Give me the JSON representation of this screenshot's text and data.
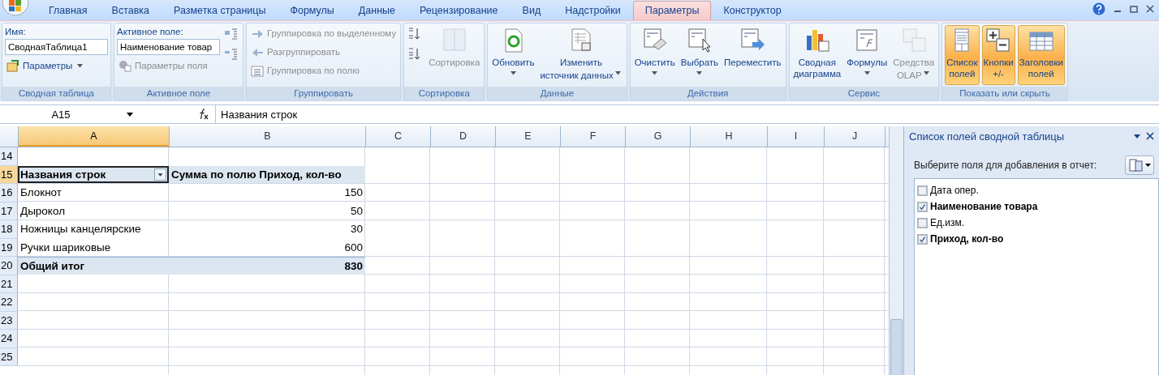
{
  "tabs": [
    {
      "label": "Главная",
      "selected": false
    },
    {
      "label": "Вставка",
      "selected": false
    },
    {
      "label": "Разметка страницы",
      "selected": false
    },
    {
      "label": "Формулы",
      "selected": false
    },
    {
      "label": "Данные",
      "selected": false
    },
    {
      "label": "Рецензирование",
      "selected": false
    },
    {
      "label": "Вид",
      "selected": false
    },
    {
      "label": "Надстройки",
      "selected": false
    },
    {
      "label": "Параметры",
      "selected": true
    },
    {
      "label": "Конструктор",
      "selected": false
    }
  ],
  "ribbon": [
    {
      "title": "Сводная таблица",
      "columns": [
        [
          {
            "kind": "field",
            "label": "Имя:",
            "value": "СводнаяТаблица1"
          },
          {
            "kind": "small",
            "label": "Параметры",
            "dropdown": true,
            "disabled": false
          }
        ]
      ]
    },
    {
      "title": "Активное поле",
      "columns": [
        [
          {
            "kind": "field",
            "label": "Активное поле:",
            "value": "Наименование товар"
          },
          {
            "kind": "small",
            "label": "Параметры поля",
            "dropdown": false,
            "disabled": true
          }
        ],
        [
          {
            "kind": "icon",
            "disabled": false
          },
          {
            "kind": "icon",
            "disabled": false
          }
        ]
      ]
    },
    {
      "title": "Группировать",
      "columns": [
        [
          {
            "kind": "small",
            "label": "Группировка по выделенному",
            "dropdown": false,
            "disabled": true
          },
          {
            "kind": "small",
            "label": "Разгруппировать",
            "dropdown": false,
            "disabled": true
          },
          {
            "kind": "small",
            "label": "Группировка по полю",
            "dropdown": false,
            "disabled": true
          }
        ]
      ]
    },
    {
      "title": "Сортировка",
      "columns": [
        [
          {
            "kind": "icon",
            "disabled": false
          },
          {
            "kind": "icon",
            "disabled": false
          }
        ],
        [
          {
            "kind": "large",
            "lines": [
              "Сортировка"
            ],
            "dropdown": false,
            "disabled": true,
            "pressed": false
          }
        ]
      ]
    },
    {
      "title": "Данные",
      "columns": [
        [
          {
            "kind": "large",
            "lines": [
              "Обновить"
            ],
            "dropdown": true,
            "disabled": false,
            "pressed": false
          }
        ],
        [
          {
            "kind": "large",
            "lines": [
              "Изменить",
              "источник данных"
            ],
            "dropdown": true,
            "disabled": false,
            "pressed": false
          }
        ]
      ]
    },
    {
      "title": "Действия",
      "columns": [
        [
          {
            "kind": "large",
            "lines": [
              "Очистить"
            ],
            "dropdown": true,
            "disabled": false,
            "pressed": false
          }
        ],
        [
          {
            "kind": "large",
            "lines": [
              "Выбрать"
            ],
            "dropdown": true,
            "disabled": false,
            "pressed": false
          }
        ],
        [
          {
            "kind": "large",
            "lines": [
              "Переместить"
            ],
            "dropdown": false,
            "disabled": false,
            "pressed": false
          }
        ]
      ]
    },
    {
      "title": "Сервис",
      "columns": [
        [
          {
            "kind": "large",
            "lines": [
              "Сводная",
              "диаграмма"
            ],
            "dropdown": false,
            "disabled": false,
            "pressed": false
          }
        ],
        [
          {
            "kind": "large",
            "lines": [
              "Формулы"
            ],
            "dropdown": true,
            "disabled": false,
            "pressed": false
          }
        ],
        [
          {
            "kind": "large",
            "lines": [
              "Средства",
              "OLAP"
            ],
            "dropdown": true,
            "disabled": true,
            "pressed": false
          }
        ]
      ]
    },
    {
      "title": "Показать или скрыть",
      "columns": [
        [
          {
            "kind": "large",
            "lines": [
              "Список",
              "полей"
            ],
            "dropdown": false,
            "disabled": false,
            "pressed": true
          }
        ],
        [
          {
            "kind": "large",
            "lines": [
              "Кнопки",
              "+/-"
            ],
            "dropdown": false,
            "disabled": false,
            "pressed": true
          }
        ],
        [
          {
            "kind": "large",
            "lines": [
              "Заголовки",
              "полей"
            ],
            "dropdown": false,
            "disabled": false,
            "pressed": true
          }
        ]
      ]
    }
  ],
  "formula_bar": {
    "name_box": "A15",
    "formula": "Названия строк"
  },
  "sheet": {
    "columns": [
      {
        "label": "A",
        "selected": true
      },
      {
        "label": "B",
        "selected": false
      },
      {
        "label": "C",
        "selected": false
      },
      {
        "label": "D",
        "selected": false
      },
      {
        "label": "E",
        "selected": false
      },
      {
        "label": "F",
        "selected": false
      },
      {
        "label": "G",
        "selected": false
      },
      {
        "label": "H",
        "selected": false
      },
      {
        "label": "I",
        "selected": false
      },
      {
        "label": "J",
        "selected": false
      }
    ],
    "rows": [
      {
        "number": "14",
        "kind": "empty",
        "selected": false
      },
      {
        "number": "15",
        "kind": "header",
        "label": "Названия строк",
        "value": "Сумма по полю Приход, кол-во",
        "selected": true
      },
      {
        "number": "16",
        "kind": "item",
        "label": "Блокнот",
        "value": "150",
        "selected": false
      },
      {
        "number": "17",
        "kind": "item",
        "label": "Дырокол",
        "value": "50",
        "selected": false
      },
      {
        "number": "18",
        "kind": "item",
        "label": "Ножницы канцелярские",
        "value": "30",
        "selected": false
      },
      {
        "number": "19",
        "kind": "item",
        "label": "Ручки шариковые",
        "value": "600",
        "selected": false
      },
      {
        "number": "20",
        "kind": "total",
        "label": "Общий итог",
        "value": "830",
        "selected": false
      },
      {
        "number": "21",
        "kind": "empty",
        "selected": false
      },
      {
        "number": "22",
        "kind": "empty",
        "selected": false
      },
      {
        "number": "23",
        "kind": "empty",
        "selected": false
      },
      {
        "number": "24",
        "kind": "empty",
        "selected": false
      },
      {
        "number": "25",
        "kind": "empty",
        "selected": false
      }
    ]
  },
  "field_list": {
    "title": "Список полей сводной таблицы",
    "prompt": "Выберите поля для добавления в отчет:",
    "fields": [
      {
        "label": "Дата опер.",
        "checked": false
      },
      {
        "label": "Наименование товара",
        "checked": true
      },
      {
        "label": "Ед.изм.",
        "checked": false
      },
      {
        "label": "Приход, кол-во",
        "checked": true
      }
    ]
  }
}
